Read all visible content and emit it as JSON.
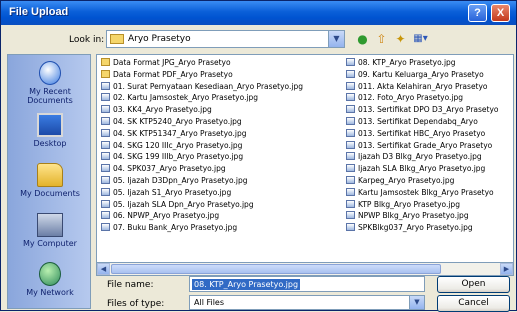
{
  "window": {
    "title": "File Upload",
    "help_label": "?",
    "close_label": "X"
  },
  "toolbar": {
    "look_in_label": "Look in:",
    "look_in_value": "Aryo Prasetyo",
    "icons": [
      "back-icon",
      "up-folder-icon",
      "new-folder-icon",
      "views-icon"
    ]
  },
  "places": [
    {
      "label": "My Recent Documents",
      "icon": "recent-documents-icon"
    },
    {
      "label": "Desktop",
      "icon": "desktop-icon"
    },
    {
      "label": "My Documents",
      "icon": "my-documents-icon"
    },
    {
      "label": "My Computer",
      "icon": "my-computer-icon"
    },
    {
      "label": "My Network",
      "icon": "my-network-icon"
    }
  ],
  "files_col1": [
    {
      "name": "Data Format JPG_Aryo Prasetyo",
      "type": "folder"
    },
    {
      "name": "Data Format PDF_Aryo Prasetyo",
      "type": "folder"
    },
    {
      "name": "01. Surat Pernyataan Kesediaan_Aryo Prasetyo.jpg",
      "type": "image"
    },
    {
      "name": "02. Kartu Jamsostek_Aryo Prasetyo.jpg",
      "type": "image"
    },
    {
      "name": "03. KK4_Aryo Prasetyo.jpg",
      "type": "image"
    },
    {
      "name": "04. SK KTP5240_Aryo Prasetyo.jpg",
      "type": "image"
    },
    {
      "name": "04. SK KTP51347_Aryo Prasetyo.jpg",
      "type": "image"
    },
    {
      "name": "04. SKG 120 IIIc_Aryo Prasetyo.jpg",
      "type": "image"
    },
    {
      "name": "04. SKG 199 IIIb_Aryo Prasetyo.jpg",
      "type": "image"
    },
    {
      "name": "04. SPK037_Aryo Prasetyo.jpg",
      "type": "image"
    },
    {
      "name": "05. Ijazah D3Dpn_Aryo Prasetyo.jpg",
      "type": "image"
    },
    {
      "name": "05. Ijazah S1_Aryo Prasetyo.jpg",
      "type": "image"
    },
    {
      "name": "05. Ijazah SLA Dpn_Aryo Prasetyo.jpg",
      "type": "image"
    },
    {
      "name": "06. NPWP_Aryo Prasetyo.jpg",
      "type": "image"
    },
    {
      "name": "07. Buku Bank_Aryo Prasetyo.jpg",
      "type": "image"
    }
  ],
  "files_col2": [
    {
      "name": "08. KTP_Aryo Prasetyo.jpg",
      "type": "image"
    },
    {
      "name": "09. Kartu Keluarga_Aryo Prasetyo",
      "type": "image"
    },
    {
      "name": "011. Akta Kelahiran_Aryo Prasetyo",
      "type": "image"
    },
    {
      "name": "012. Foto_Aryo Prasetyo.jpg",
      "type": "image"
    },
    {
      "name": "013. Sertifikat DPO D3_Aryo Prasetyo",
      "type": "image"
    },
    {
      "name": "013. Sertifikat Dependabq_Aryo",
      "type": "image"
    },
    {
      "name": "013. Sertifikat HBC_Aryo Prasetyo",
      "type": "image"
    },
    {
      "name": "013. Sertifikat Grade_Aryo Prasetyo",
      "type": "image"
    },
    {
      "name": "Ijazah D3 Blkg_Aryo Prasetyo.jpg",
      "type": "image"
    },
    {
      "name": "Ijazah SLA Blkg_Aryo Prasetyo.jpg",
      "type": "image"
    },
    {
      "name": "Karpeg_Aryo Prasetyo.jpg",
      "type": "image"
    },
    {
      "name": "Kartu Jamsostek Blkg_Aryo Prasetyo",
      "type": "image"
    },
    {
      "name": "KTP Blkg_Aryo Prasetyo.jpg",
      "type": "image"
    },
    {
      "name": "NPWP Blkg_Aryo Prasetyo.jpg",
      "type": "image"
    },
    {
      "name": "SPKBlkg037_Aryo Prasetyo.jpg",
      "type": "image"
    }
  ],
  "form": {
    "file_name_label": "File name:",
    "file_name_value": "08. KTP_Aryo Prasetyo.jpg",
    "file_type_label": "Files of type:",
    "file_type_value": "All Files",
    "open_label": "Open",
    "cancel_label": "Cancel"
  }
}
